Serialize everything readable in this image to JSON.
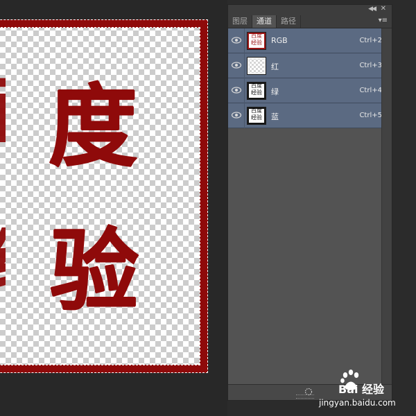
{
  "canvas": {
    "characters": {
      "main_top": "度",
      "main_bottom": "验",
      "edge_top": "百",
      "edge_bottom": "经"
    },
    "frame_color": "#8f0a0a"
  },
  "panel": {
    "tabs": [
      {
        "label": "图层",
        "active": false
      },
      {
        "label": "通道",
        "active": true
      },
      {
        "label": "路径",
        "active": false
      }
    ],
    "channels": [
      {
        "name": "RGB",
        "shortcut": "Ctrl+2",
        "visible": true,
        "thumb": "rgb"
      },
      {
        "name": "红",
        "shortcut": "Ctrl+3",
        "visible": true,
        "thumb": "red"
      },
      {
        "name": "绿",
        "shortcut": "Ctrl+4",
        "visible": true,
        "thumb": "dark"
      },
      {
        "name": "蓝",
        "shortcut": "Ctrl+5",
        "visible": true,
        "thumb": "dark"
      }
    ],
    "thumb_text": {
      "line1": "百度",
      "line2": "经验"
    },
    "icons": [
      "collapse-icon",
      "close-icon",
      "panel-menu-icon",
      "eye-icon",
      "load-selection-icon"
    ],
    "selected_row_color": "#5b6a82"
  },
  "watermark": {
    "brand": "Bai 经验",
    "url": "jingyan.baidu.com"
  }
}
